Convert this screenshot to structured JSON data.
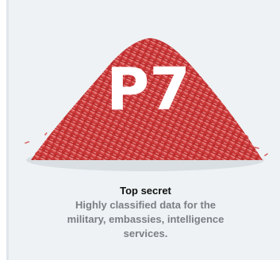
{
  "card": {
    "badge": "P7",
    "title": "Top secret",
    "description": "Highly classified data for the military, embassies, intelligence services.",
    "colors": {
      "panel_background": "#eef2f4",
      "shred_primary": "#d23a3a",
      "shred_light": "#f2b1b1",
      "badge_text": "#ffffff",
      "title_text": "#111111",
      "description_text": "#7a7f84"
    },
    "illustration": "shredded-paper-pile"
  }
}
